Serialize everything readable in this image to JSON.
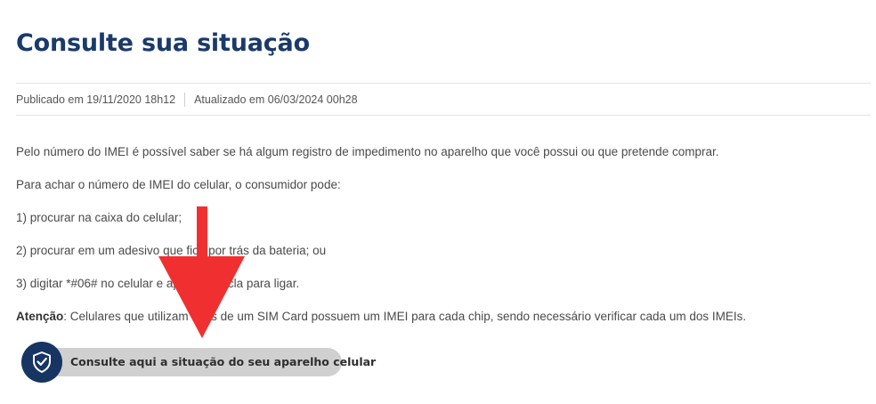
{
  "page": {
    "title": "Consulte sua situação"
  },
  "meta": {
    "published": "Publicado em 19/11/2020 18h12",
    "updated": "Atualizado em 06/03/2024 00h28"
  },
  "content": {
    "paragraph_1": "Pelo número do IMEI é possível saber se há algum registro de impedimento no aparelho que você possui ou que pretende comprar.",
    "paragraph_2": "Para achar o número de IMEI do celular, o consumidor pode:",
    "step_1": "1) procurar na caixa do celular;",
    "step_2": "2) procurar em um adesivo que fica por trás da bateria; ou",
    "step_3": "3) digitar *#06# no celular e apertar a tecla para ligar.",
    "attention_label": "Atenção",
    "attention_text": ": Celulares que utilizam mais de um SIM Card possuem um IMEI para cada chip, sendo necessário verificar cada um dos IMEIs."
  },
  "cta": {
    "label": "Consulte aqui a situação do seu aparelho celular",
    "icon": "shield-check-icon"
  },
  "annotation": {
    "arrow_color": "#f03030"
  },
  "colors": {
    "title": "#1a3a6b",
    "cta_circle": "#173563",
    "cta_pill": "#d0d0d0"
  }
}
